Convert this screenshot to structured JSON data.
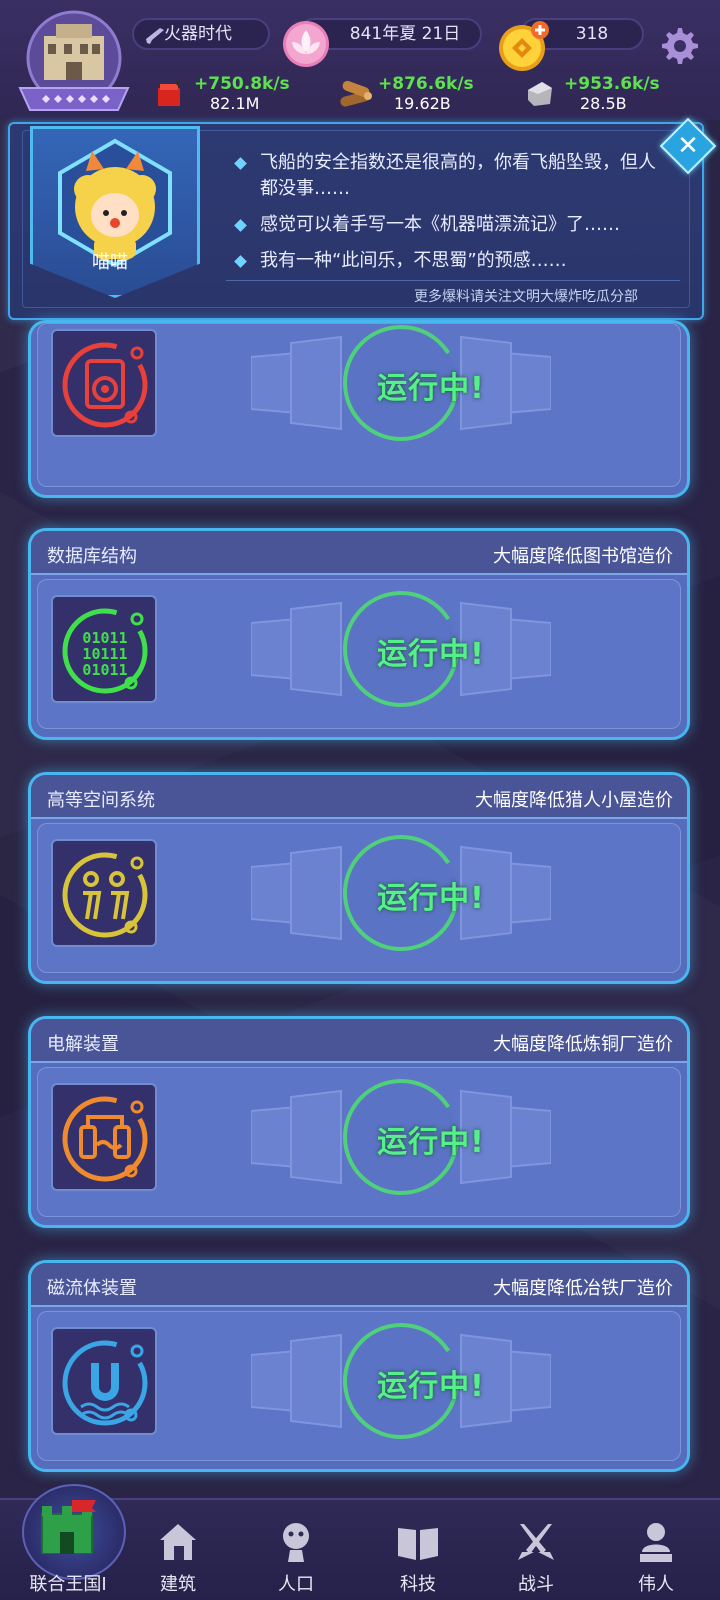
{
  "hud": {
    "era": "火器时代",
    "date": "841年夏 21日",
    "coins": "318",
    "resources": [
      {
        "name": "food-resource",
        "rate": "+750.8k/s",
        "amount": "82.1M"
      },
      {
        "name": "wood-resource",
        "rate": "+876.6k/s",
        "amount": "19.62B"
      },
      {
        "name": "stone-resource",
        "rate": "+953.6k/s",
        "amount": "28.5B"
      }
    ]
  },
  "notice": {
    "speaker": "喵喵",
    "lines": [
      "飞船的安全指数还是很高的，你看飞船坠毁，但人都没事……",
      "感觉可以着手写一本《机器喵漂流记》了……",
      "我有一种“此间乐，不思蜀”的预感……"
    ],
    "footer": "更多爆料请关注文明大爆炸吃瓜分部"
  },
  "cards": [
    {
      "title": "",
      "effect": "",
      "status": "运行中!",
      "icon": "speaker-icon",
      "color": "#e8403a"
    },
    {
      "title": "数据库结构",
      "effect": "大幅度降低图书馆造价",
      "status": "运行中!",
      "icon": "binary-data-icon",
      "color": "#3fe04a"
    },
    {
      "title": "高等空间系统",
      "effect": "大幅度降低猎人小屋造价",
      "status": "运行中!",
      "icon": "space-system-icon",
      "color": "#d8c43a"
    },
    {
      "title": "电解装置",
      "effect": "大幅度降低炼铜厂造价",
      "status": "运行中!",
      "icon": "electrolysis-icon",
      "color": "#f08a2e"
    },
    {
      "title": "磁流体装置",
      "effect": "大幅度降低冶铁厂造价",
      "status": "运行中!",
      "icon": "magnet-icon",
      "color": "#3aa6e6"
    }
  ],
  "nav": [
    {
      "label": "联合王国I",
      "icon": "castle-icon",
      "active": true
    },
    {
      "label": "建筑",
      "icon": "house-icon",
      "active": false
    },
    {
      "label": "人口",
      "icon": "person-icon",
      "active": false
    },
    {
      "label": "科技",
      "icon": "book-icon",
      "active": false
    },
    {
      "label": "战斗",
      "icon": "crossed-swords-icon",
      "active": false
    },
    {
      "label": "伟人",
      "icon": "bust-icon",
      "active": false
    }
  ]
}
